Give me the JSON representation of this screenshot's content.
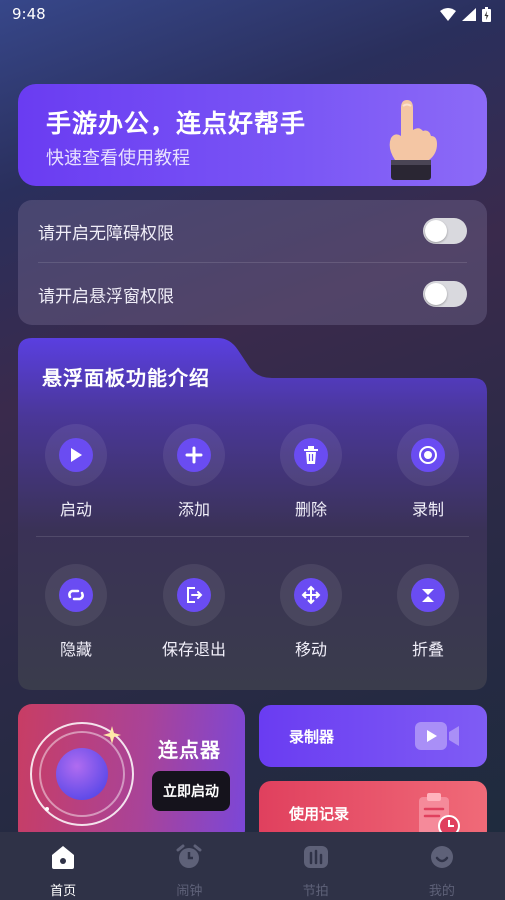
{
  "status_bar": {
    "time": "9:48"
  },
  "banner": {
    "title": "手游办公，连点好帮手",
    "subtitle": "快速查看使用教程"
  },
  "permissions": [
    {
      "label": "请开启无障碍权限",
      "enabled": false
    },
    {
      "label": "请开启悬浮窗权限",
      "enabled": false
    }
  ],
  "panel": {
    "title": "悬浮面板功能介绍",
    "features": [
      {
        "label": "启动",
        "icon": "play-icon"
      },
      {
        "label": "添加",
        "icon": "plus-icon"
      },
      {
        "label": "删除",
        "icon": "trash-icon"
      },
      {
        "label": "录制",
        "icon": "record-icon"
      },
      {
        "label": "隐藏",
        "icon": "hide-icon"
      },
      {
        "label": "保存退出",
        "icon": "save-exit-icon"
      },
      {
        "label": "移动",
        "icon": "move-icon"
      },
      {
        "label": "折叠",
        "icon": "collapse-icon"
      }
    ]
  },
  "clicker": {
    "title": "连点器",
    "button": "立即启动"
  },
  "recorder": {
    "title": "录制器"
  },
  "history": {
    "title": "使用记录"
  },
  "nav": [
    {
      "label": "首页",
      "icon": "home-icon",
      "active": true
    },
    {
      "label": "闹钟",
      "icon": "alarm-icon",
      "active": false
    },
    {
      "label": "节拍",
      "icon": "metronome-icon",
      "active": false
    },
    {
      "label": "我的",
      "icon": "profile-icon",
      "active": false
    }
  ],
  "colors": {
    "accent": "#6a4cf2",
    "clicker_gradient_start": "#c83d64",
    "history_red": "#e0405e",
    "nav_bg": "#2f3247"
  }
}
